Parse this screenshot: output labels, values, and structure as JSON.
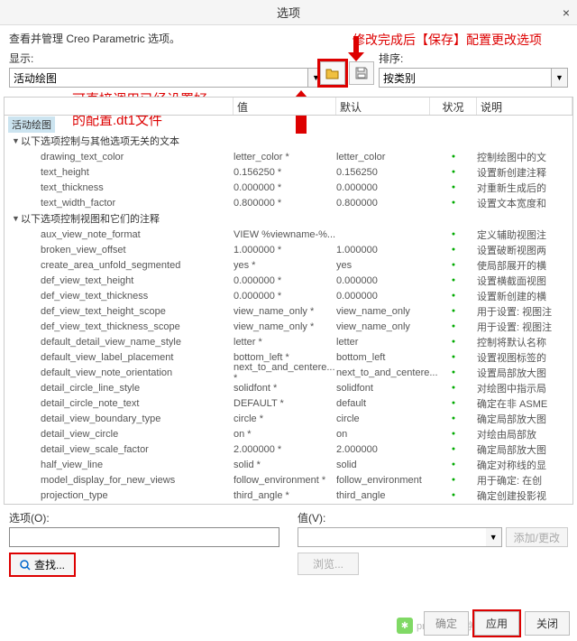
{
  "window": {
    "title": "选项",
    "close": "×"
  },
  "subtitle": "查看并管理 Creo Parametric 选项。",
  "anno_top": "修改完成后【保存】配置更改选项",
  "anno_mid_l1": "可直接调用已经设置好",
  "anno_mid_l2": "的配置.dt1文件",
  "left": {
    "label": "显示:",
    "value": "活动绘图"
  },
  "right": {
    "label": "排序:",
    "value": "按类别"
  },
  "headers": {
    "h1": "",
    "h2": "值",
    "h3": "默认",
    "h4": "状况",
    "h5": "说明"
  },
  "section": "活动绘图",
  "group1": "以下选项控制与其他选项无关的文本",
  "group2": "以下选项控制视图和它们的注释",
  "rows1": [
    {
      "p": "drawing_text_color",
      "v": "letter_color *",
      "d": "letter_color",
      "s": "控制绘图中的文"
    },
    {
      "p": "text_height",
      "v": "0.156250 *",
      "d": "0.156250",
      "s": "设置新创建注释"
    },
    {
      "p": "text_thickness",
      "v": "0.000000 *",
      "d": "0.000000",
      "s": "对重新生成后的"
    },
    {
      "p": "text_width_factor",
      "v": "0.800000 *",
      "d": "0.800000",
      "s": "设置文本宽度和"
    }
  ],
  "rows2": [
    {
      "p": "aux_view_note_format",
      "v": "VIEW %viewname-%...",
      "d": "",
      "s": "定义辅助视图注"
    },
    {
      "p": "broken_view_offset",
      "v": "1.000000 *",
      "d": "1.000000",
      "s": "设置破断视图两"
    },
    {
      "p": "create_area_unfold_segmented",
      "v": "yes *",
      "d": "yes",
      "s": "使局部展开的横"
    },
    {
      "p": "def_view_text_height",
      "v": "0.000000 *",
      "d": "0.000000",
      "s": "设置横截面视图"
    },
    {
      "p": "def_view_text_thickness",
      "v": "0.000000 *",
      "d": "0.000000",
      "s": "设置新创建的横"
    },
    {
      "p": "def_view_text_height_scope",
      "v": "view_name_only *",
      "d": "view_name_only",
      "s": "用于设置: 视图注"
    },
    {
      "p": "def_view_text_thickness_scope",
      "v": "view_name_only *",
      "d": "view_name_only",
      "s": "用于设置: 视图注"
    },
    {
      "p": "default_detail_view_name_style",
      "v": "letter *",
      "d": "letter",
      "s": "控制将默认名称"
    },
    {
      "p": "default_view_label_placement",
      "v": "bottom_left *",
      "d": "bottom_left",
      "s": "设置视图标签的"
    },
    {
      "p": "default_view_note_orientation",
      "v": "next_to_and_centere... *",
      "d": "next_to_and_centere...",
      "s": "设置局部放大图"
    },
    {
      "p": "detail_circle_line_style",
      "v": "solidfont *",
      "d": "solidfont",
      "s": "对绘图中指示局"
    },
    {
      "p": "detail_circle_note_text",
      "v": "DEFAULT *",
      "d": "default",
      "s": "确定在非 ASME"
    },
    {
      "p": "detail_view_boundary_type",
      "v": "circle *",
      "d": "circle",
      "s": "确定局部放大图"
    },
    {
      "p": "detail_view_circle",
      "v": "on *",
      "d": "on",
      "s": "对绘由局部放"
    },
    {
      "p": "detail_view_scale_factor",
      "v": "2.000000 *",
      "d": "2.000000",
      "s": "确定局部放大图"
    },
    {
      "p": "half_view_line",
      "v": "solid *",
      "d": "solid",
      "s": "确定对称线的显"
    },
    {
      "p": "model_display_for_new_views",
      "v": "follow_environment *",
      "d": "follow_environment",
      "s": "用于确定: 在创"
    },
    {
      "p": "projection_type",
      "v": "third_angle *",
      "d": "third_angle",
      "s": "确定创建投影视"
    }
  ],
  "bottom": {
    "opt_label": "选项(O):",
    "val_label": "值(V):",
    "find": "查找...",
    "browse": "浏览...",
    "add": "添加/更改"
  },
  "footer": {
    "ok": "确定",
    "apply": "应用",
    "close": "关闭"
  },
  "wechat": "proe和creo学习"
}
